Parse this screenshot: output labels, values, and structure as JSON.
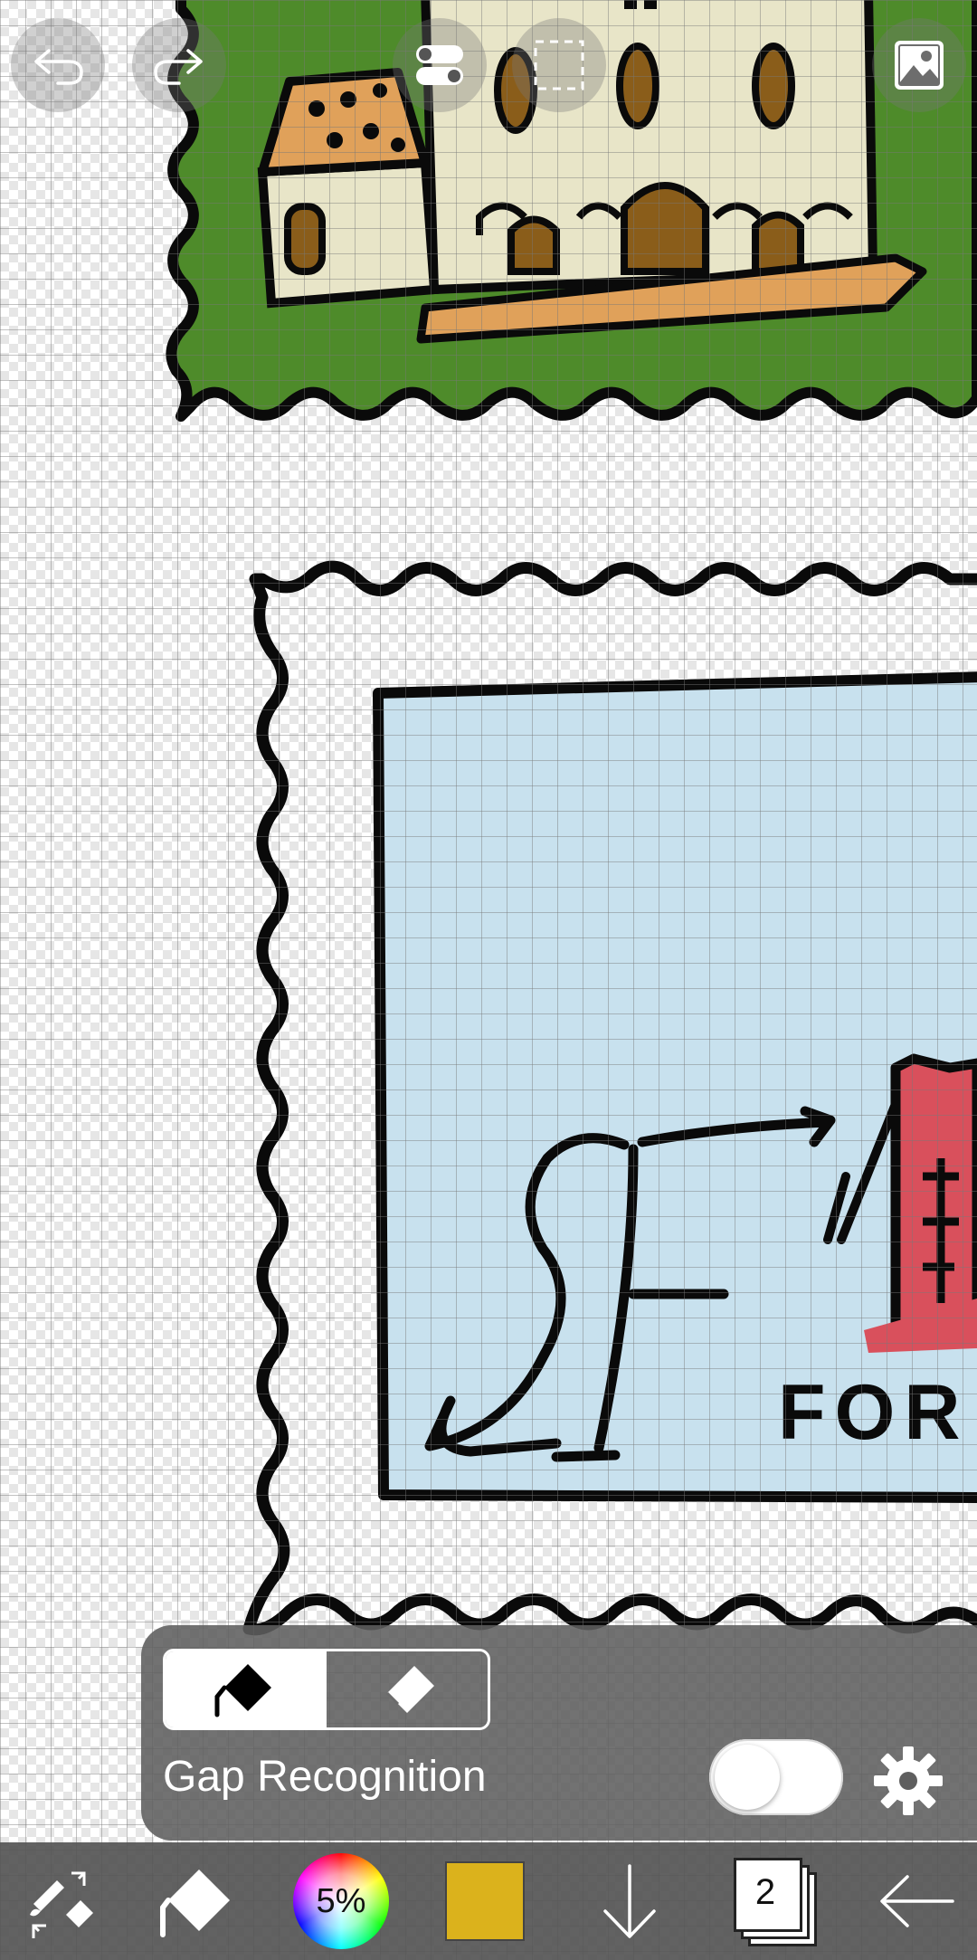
{
  "fill_panel": {
    "modes": [
      "fill",
      "erase"
    ],
    "gap_recognition_label": "Gap Recognition",
    "gap_recognition_enabled": false
  },
  "toolbar": {
    "brush_opacity_label": "5%",
    "current_color": "#dbb21c",
    "layer_count": "2"
  },
  "canvas": {
    "stamp_text": "FOR",
    "stamp_letters": "SF"
  },
  "colors": {
    "stamp_green": "#4e8b2a",
    "stamp_sky": "#c8e1ee",
    "building_cream": "#e8e5c8",
    "roof_orange": "#e0a15a",
    "door_brown": "#8a5d1a",
    "tower_red": "#d9505c"
  }
}
